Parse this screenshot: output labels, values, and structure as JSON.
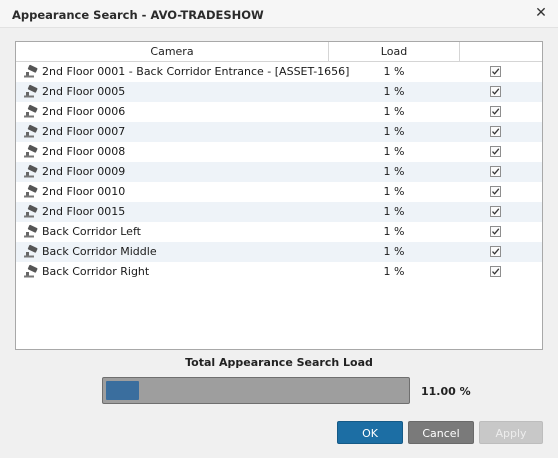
{
  "window": {
    "title": "Appearance Search - AVO-TRADESHOW",
    "close_glyph": "✕"
  },
  "table": {
    "columns": {
      "camera": "Camera",
      "load": "Load",
      "select_all_checked": true
    },
    "rows": [
      {
        "camera": "2nd Floor 0001 - Back Corridor Entrance - [ASSET-1656]",
        "load": "1 %",
        "checked": true
      },
      {
        "camera": "2nd Floor 0005",
        "load": "1 %",
        "checked": true
      },
      {
        "camera": "2nd Floor 0006",
        "load": "1 %",
        "checked": true
      },
      {
        "camera": "2nd Floor 0007",
        "load": "1 %",
        "checked": true
      },
      {
        "camera": "2nd Floor 0008",
        "load": "1 %",
        "checked": true
      },
      {
        "camera": "2nd Floor 0009",
        "load": "1 %",
        "checked": true
      },
      {
        "camera": "2nd Floor 0010",
        "load": "1 %",
        "checked": true
      },
      {
        "camera": "2nd Floor 0015",
        "load": "1 %",
        "checked": true
      },
      {
        "camera": "Back Corridor Left",
        "load": "1 %",
        "checked": true
      },
      {
        "camera": "Back Corridor Middle",
        "load": "1 %",
        "checked": true
      },
      {
        "camera": "Back Corridor Right",
        "load": "1 %",
        "checked": true
      }
    ]
  },
  "total_load": {
    "label": "Total Appearance Search Load",
    "value_text": "11.00 %",
    "fraction": 0.11
  },
  "buttons": {
    "ok": "OK",
    "cancel": "Cancel",
    "apply": "Apply"
  },
  "colors": {
    "accent": "#1c6ea4",
    "bar_fill": "#3a6e9e",
    "row_alt": "#eef3f8"
  }
}
